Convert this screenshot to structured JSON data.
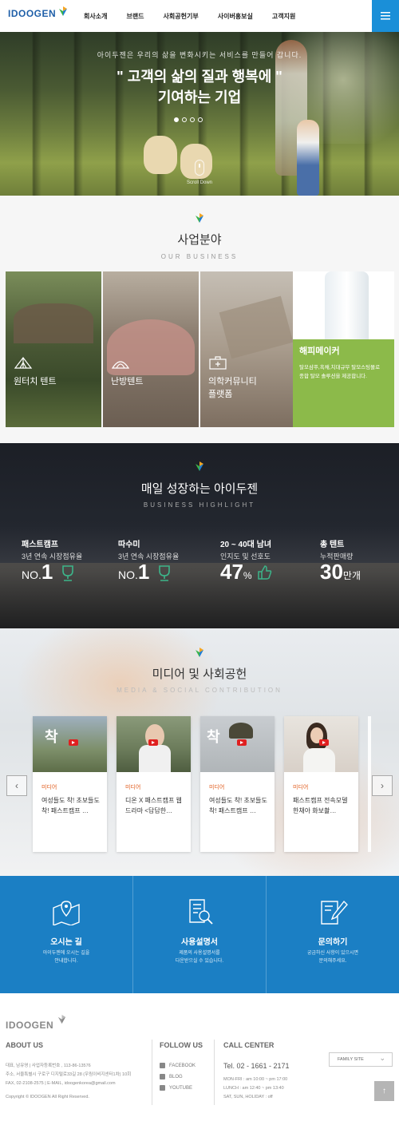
{
  "header": {
    "logo": "IDOOGEN",
    "nav": [
      "회사소개",
      "브랜드",
      "사회공헌기부",
      "사이버홍보실",
      "고객지원"
    ]
  },
  "hero": {
    "subtitle": "아이두젠은 우리의 삶을 변화시키는 서비스를 만들어 갑니다.",
    "title_line1": "\" 고객의 삶의 질과 행복에 \"",
    "title_line2": "기여하는 기업",
    "slides": 4,
    "active_slide": 1,
    "scroll_label": "Scroll Down"
  },
  "business": {
    "title": "사업분야",
    "subtitle": "OUR BUSINESS",
    "cards": [
      {
        "label": "원터치 텐트",
        "icon": "tent-icon"
      },
      {
        "label": "난방텐트",
        "icon": "tent-outline-icon"
      },
      {
        "label": "의학커뮤니티\n플랫폼",
        "icon": "medical-kit-icon"
      }
    ],
    "promo": {
      "brand": "해피메이커",
      "text": "탈모샴푸,흑채,치대규무 탈모스팅몰로\n종합 탈모 솔루션을 제공합니다."
    }
  },
  "highlight": {
    "title": "매일 성장하는 아이두젠",
    "subtitle": "BUSINESS HIGHLIGHT",
    "items": [
      {
        "t1": "패스트캠프",
        "t2": "3년 연속 시장점유율",
        "prefix": "NO.",
        "num": "1",
        "unit": ""
      },
      {
        "t1": "따수미",
        "t2": "3년 연속 시장점유율",
        "prefix": "NO.",
        "num": "1",
        "unit": ""
      },
      {
        "t1": "20 ~ 40대 남녀",
        "t2": "인지도 및 선호도",
        "prefix": "",
        "num": "47",
        "unit": "%"
      },
      {
        "t1": "총 텐트",
        "t2": "누적판매량",
        "prefix": "",
        "num": "30",
        "unit": "만개"
      }
    ]
  },
  "media": {
    "title": "미디어 및 사회공헌",
    "subtitle": "MEDIA & SOCIAL CONTRIBUTION",
    "cards": [
      {
        "category": "미디어",
        "text": "여성들도 착! 초보들도 착! 패스트캠프 …",
        "overlay": "착"
      },
      {
        "category": "미디어",
        "text": "디온 X 패스트캠프 웹드라마 <답답한…",
        "overlay": ""
      },
      {
        "category": "미디어",
        "text": "여성들도 착! 초보들도 착! 패스트캠프 …",
        "overlay": "착"
      },
      {
        "category": "미디어",
        "text": "패스트캠프 전속모델 한채아 화보촬…",
        "overlay": ""
      }
    ]
  },
  "services": [
    {
      "title": "오시는 길",
      "desc": "아이두젠에 오시는 길을\n안내합니다.",
      "icon": "map-pin-icon"
    },
    {
      "title": "사용설명서",
      "desc": "제품의 사용설명서를\n다운받으실 수 있습니다.",
      "icon": "document-search-icon"
    },
    {
      "title": "문의하기",
      "desc": "궁금하신 사항이 있으시면\n문의해주세요.",
      "icon": "edit-note-icon"
    }
  ],
  "footer": {
    "logo": "IDOOGEN",
    "about_title": "ABOUT US",
    "about_lines": [
      "대표, 남유영  |  사업자등록번호 , 113-86-13576",
      "주소, 서울특별시 구로구 디지털로33길 28 (우림이비지센터1차) 10회",
      "FAX, 02-2108-2575  |  E-MAIL, idoogenkorea@gmail.com",
      "Copyright © IDOOGEN All Right Reserved."
    ],
    "follow_title": "FOLLOW US",
    "social": [
      "FACEBOOK",
      "BLOG",
      "YOUTUBE"
    ],
    "call_title": "CALL CENTER",
    "tel": "Tel. 02 - 1661 - 2171",
    "hours": [
      "MON-FRI : am 10:00 ~ pm 17:00",
      "LUNCH : am 12:40 ~ pm 13:40",
      "SAT, SUN, HOLIDAY : off"
    ],
    "family_site": "FAMILY SITE",
    "top_label": "↑"
  },
  "colors": {
    "brand_blue": "#1b7fc4",
    "accent_orange": "#e05a1a",
    "promo_green": "#8cba4a"
  }
}
